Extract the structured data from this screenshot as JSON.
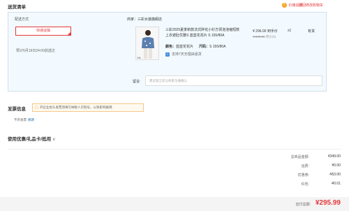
{
  "header": {
    "title": "送货清单",
    "price_help": "价格说明",
    "back_cart": "返回修改购物车"
  },
  "shipping": {
    "label": "配送方式",
    "method": "快递运输",
    "eta": "预计5月19日24:00前送达"
  },
  "item": {
    "merchant": "商家：三彩女装旗舰店",
    "name": "三彩2025夏季新款法式碎花小衫方领泡泡袖短款上衣遮肚优雅S 蓝蓝花花片 S 155/80A",
    "price": "¥ 296.00 到手价",
    "orig_price": "¥ 349.00",
    "orig_suffix": "原价(5)",
    "qty": "x1",
    "stock": "有货",
    "color_label": "颜色：",
    "color_value": "蓝蓝花花片",
    "size_label": "尺码：",
    "size_value": "S 155/80A",
    "return_icon": "7",
    "return_text": "支持7天无理由退货",
    "thumb_badge": "24h"
  },
  "remark": {
    "label": "留言:",
    "placeholder": "建议留言前与商家沟通确认"
  },
  "invoice": {
    "title": "发票信息",
    "tip": "开企业抬头发票须填写纳税人识别号，以免影响报销",
    "status": "不开发票",
    "edit": "修改"
  },
  "coupon": {
    "label": "使用优惠/礼品卡/抵用"
  },
  "summary": [
    {
      "label": "总商品金额:",
      "value": "¥349.00"
    },
    {
      "label": "运费:",
      "value": "¥0.00"
    },
    {
      "label": "优惠券:",
      "value": "-¥53.00"
    },
    {
      "label": "红包:",
      "value": "-¥0.01"
    }
  ],
  "total": {
    "label": "应付总额:",
    "value": "¥295.99"
  },
  "colors": {
    "accent": "#e4393c",
    "panel_bg": "#f3faff",
    "link": "#005ea7"
  }
}
